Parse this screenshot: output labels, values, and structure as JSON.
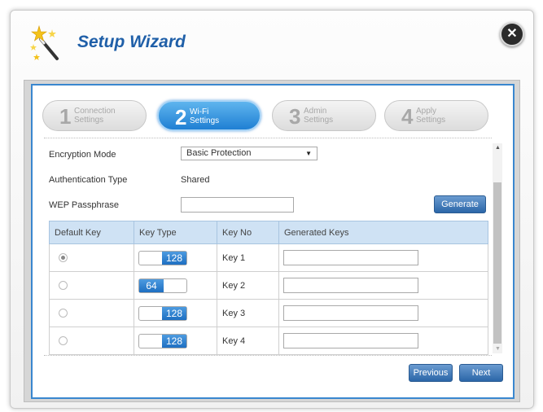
{
  "dialog": {
    "title": "Setup Wizard"
  },
  "steps": [
    {
      "num": "1",
      "line1": "Connection",
      "line2": "Settings",
      "active": false
    },
    {
      "num": "2",
      "line1": "Wi-Fi",
      "line2": "Settings",
      "active": true
    },
    {
      "num": "3",
      "line1": "Admin",
      "line2": "Settings",
      "active": false
    },
    {
      "num": "4",
      "line1": "Apply",
      "line2": "Settings",
      "active": false
    }
  ],
  "form": {
    "encryption_label": "Encryption Mode",
    "encryption_value": "Basic Protection",
    "auth_label": "Authentication Type",
    "auth_value": "Shared",
    "passphrase_label": "WEP Passphrase",
    "passphrase_value": "",
    "generate_label": "Generate"
  },
  "table": {
    "headers": [
      "Default Key",
      "Key Type",
      "Key No",
      "Generated Keys"
    ],
    "rows": [
      {
        "selected": true,
        "key_type": "128",
        "key_no": "Key 1",
        "generated": ""
      },
      {
        "selected": false,
        "key_type": "64",
        "key_no": "Key 2",
        "generated": ""
      },
      {
        "selected": false,
        "key_type": "128",
        "key_no": "Key 3",
        "generated": ""
      },
      {
        "selected": false,
        "key_type": "128",
        "key_no": "Key 4",
        "generated": ""
      }
    ]
  },
  "footer": {
    "previous_label": "Previous",
    "next_label": "Next"
  },
  "colors": {
    "accent": "#3a87cf",
    "title": "#1f5fa8",
    "button": "#2b66a8"
  }
}
